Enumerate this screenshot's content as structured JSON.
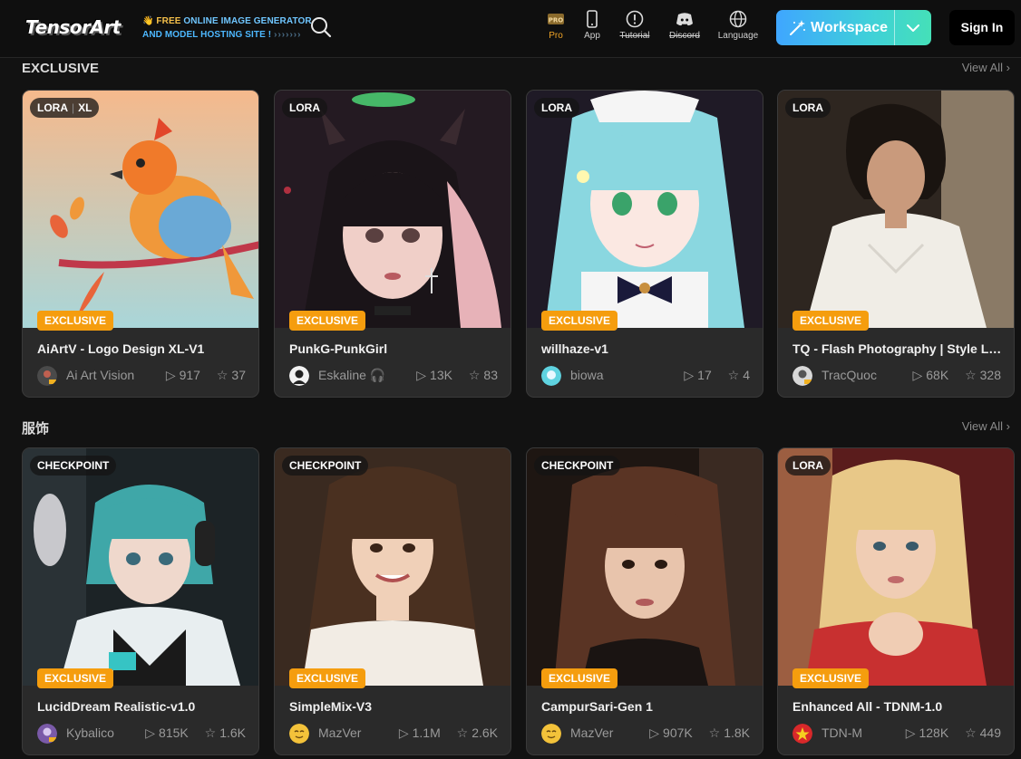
{
  "header": {
    "logo_text": "TensorArt",
    "tagline_line1_prefix": "👋 FREE ",
    "tagline_line1_highlight": "ONLINE IMAGE GENERATOR",
    "tagline_line2": "AND MODEL HOSTING SITE !",
    "tagline_arrows": "›››››››",
    "nav": [
      {
        "label": "Pro",
        "icon": "pro-icon"
      },
      {
        "label": "App",
        "icon": "phone-icon"
      },
      {
        "label": "Tutorial",
        "icon": "info-icon"
      },
      {
        "label": "Discord",
        "icon": "discord-icon"
      },
      {
        "label": "Language",
        "icon": "globe-icon"
      }
    ],
    "pro_badge": "PRO",
    "workspace_label": "Workspace",
    "signin_label": "Sign In"
  },
  "sections": [
    {
      "title": "EXCLUSIVE",
      "view_all": "View All",
      "cards": [
        {
          "type": "LORA",
          "type_extra": "XL",
          "badge": "EXCLUSIVE",
          "name": "AiArtV - Logo Design XL-V1",
          "author": "Ai Art Vision",
          "author_extra": "",
          "runs": "917",
          "stars": "37"
        },
        {
          "type": "LORA",
          "type_extra": "",
          "badge": "EXCLUSIVE",
          "name": "PunkG-PunkGirl",
          "author": "Eskaline",
          "author_extra": "🎧",
          "runs": "13K",
          "stars": "83"
        },
        {
          "type": "LORA",
          "type_extra": "",
          "badge": "EXCLUSIVE",
          "name": "willhaze-v1",
          "author": "biowa",
          "author_extra": "",
          "runs": "17",
          "stars": "4"
        },
        {
          "type": "LORA",
          "type_extra": "",
          "badge": "EXCLUSIVE",
          "name": "TQ - Flash Photography | Style Lo...",
          "author": "TracQuoc",
          "author_extra": "",
          "runs": "68K",
          "stars": "328"
        }
      ]
    },
    {
      "title": "服饰",
      "view_all": "View All",
      "cards": [
        {
          "type": "CHECKPOINT",
          "type_extra": "",
          "badge": "EXCLUSIVE",
          "name": "LucidDream Realistic-v1.0",
          "author": "Kybalico",
          "author_extra": "",
          "runs": "815K",
          "stars": "1.6K"
        },
        {
          "type": "CHECKPOINT",
          "type_extra": "",
          "badge": "EXCLUSIVE",
          "name": "SimpleMix-V3",
          "author": "MazVer",
          "author_extra": "",
          "runs": "1.1M",
          "stars": "2.6K"
        },
        {
          "type": "CHECKPOINT",
          "type_extra": "",
          "badge": "EXCLUSIVE",
          "name": "CampurSari-Gen 1",
          "author": "MazVer",
          "author_extra": "",
          "runs": "907K",
          "stars": "1.8K"
        },
        {
          "type": "LORA",
          "type_extra": "",
          "badge": "EXCLUSIVE",
          "name": "Enhanced All - TDNM-1.0",
          "author": "TDN-M",
          "author_extra": "",
          "runs": "128K",
          "stars": "449"
        }
      ]
    }
  ],
  "colors": {
    "exclusive_badge": "#f59d0e",
    "pro_label": "#f0a526",
    "workspace_gradient_start": "#3fa6ff",
    "workspace_gradient_end": "#45e0b8",
    "background": "#121212",
    "card": "#2a2a2a"
  }
}
